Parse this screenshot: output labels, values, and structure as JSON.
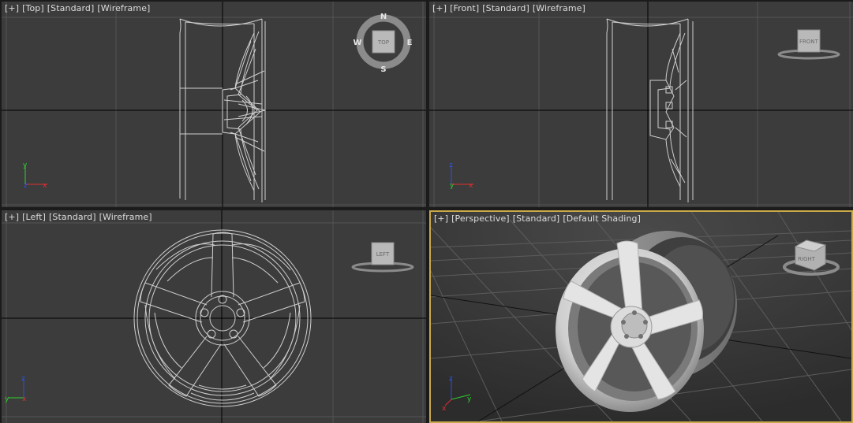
{
  "viewports": {
    "top": {
      "plus": "[+]",
      "view": "[Top]",
      "mode": "[Standard]",
      "shading": "[Wireframe]"
    },
    "front": {
      "plus": "[+]",
      "view": "[Front]",
      "mode": "[Standard]",
      "shading": "[Wireframe]"
    },
    "left": {
      "plus": "[+]",
      "view": "[Left]",
      "mode": "[Standard]",
      "shading": "[Wireframe]"
    },
    "persp": {
      "plus": "[+]",
      "view": "[Perspective]",
      "mode": "[Standard]",
      "shading": "[Default Shading]"
    }
  },
  "viewcube": {
    "top": "TOP",
    "front": "FRONT",
    "left": "LEFT",
    "right": "RIGHT",
    "compass": {
      "n": "N",
      "s": "S",
      "e": "E",
      "w": "W"
    }
  },
  "axes": {
    "x": "x",
    "y": "y",
    "z": "z"
  },
  "colors": {
    "viewport_bg": "#3c3c3c",
    "grid": "#555555",
    "world_axis": "#000000",
    "wire": "#cfcfcf",
    "active_border": "#c9a94a",
    "axis_x": "#e03030",
    "axis_y": "#2fcf2f",
    "axis_z": "#3050e0"
  }
}
